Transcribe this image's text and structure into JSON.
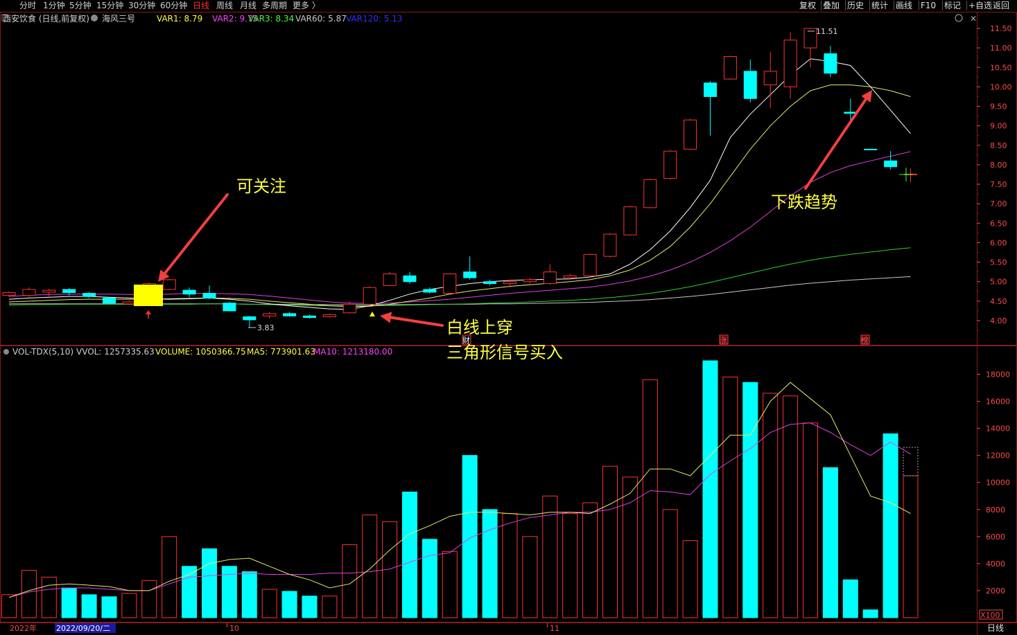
{
  "topbar": {
    "periods": [
      {
        "label": "分时",
        "active": false
      },
      {
        "label": "1分钟",
        "active": false
      },
      {
        "label": "5分钟",
        "active": false
      },
      {
        "label": "15分钟",
        "active": false
      },
      {
        "label": "30分钟",
        "active": false
      },
      {
        "label": "60分钟",
        "active": false
      },
      {
        "label": "日线",
        "active": true
      },
      {
        "label": "周线",
        "active": false
      },
      {
        "label": "月线",
        "active": false
      },
      {
        "label": "多周期",
        "active": false
      },
      {
        "label": "更多 〉",
        "active": false
      }
    ],
    "right_buttons": [
      "复权",
      "叠加",
      "历史",
      "统计",
      "画线",
      "F10",
      "标记",
      "+自选",
      "返回"
    ]
  },
  "main_panel": {
    "stock_title": "西安饮食 (日线,前复权)",
    "indicator_name": "海风三号",
    "legend": [
      {
        "label": "VAR1: 8.79",
        "color": "#ffff40"
      },
      {
        "label": "VAR2: 9.75",
        "color": "#ff40ff"
      },
      {
        "label": "VAR3: 8.34",
        "color": "#40ff40"
      },
      {
        "label": "VAR60: 5.87",
        "color": "#c8c8c8"
      },
      {
        "label": "VAR120: 5.13",
        "color": "#3030ff"
      }
    ],
    "price_axis": [
      "11.50",
      "11.00",
      "10.50",
      "10.00",
      "9.50",
      "9.00",
      "8.50",
      "8.00",
      "7.50",
      "7.00",
      "6.50",
      "6.00",
      "5.50",
      "5.00",
      "4.50",
      "4.00"
    ],
    "high_label": "11.51",
    "low_label": "3.83",
    "event_markers": [
      "财",
      "涨",
      "榜"
    ]
  },
  "annotations": {
    "watch": "可关注",
    "cross_line1": "白线上穿",
    "cross_line2": "三角形信号买入",
    "down": "下跌趋势"
  },
  "volume_panel": {
    "title": "VOL-TDX(5,10)",
    "legend": [
      {
        "label": "VVOL: 1257335.63",
        "color": "#c8c8c8"
      },
      {
        "label": "VOLUME: 1050366.75",
        "color": "#ffff40"
      },
      {
        "label": "MA5: 773901.63",
        "color": "#ffff40"
      },
      {
        "label": "MA10: 1213180.00",
        "color": "#ff40ff"
      }
    ],
    "vol_axis": [
      "18000",
      "16000",
      "14000",
      "12000",
      "10000",
      "8000",
      "6000",
      "4000",
      "2000"
    ],
    "multiplier": "X100"
  },
  "date_axis": {
    "year": "2022年",
    "cursor_date": "2022/09/20/二",
    "month_marks": [
      "10",
      "11"
    ],
    "period_label": "日线"
  },
  "colors": {
    "up": "#ff3232",
    "down": "#00ffff",
    "grid": "#8b1a1a",
    "axis_text": "#ff4a4a"
  },
  "chart_data": {
    "type": "candlestick",
    "price_ylim": [
      3.5,
      11.8
    ],
    "volume_ylim": [
      0,
      19200
    ],
    "candles": [
      {
        "o": 4.65,
        "c": 4.72,
        "h": 4.75,
        "l": 4.6,
        "v": 1700
      },
      {
        "o": 4.65,
        "c": 4.8,
        "h": 4.85,
        "l": 4.6,
        "v": 3500
      },
      {
        "o": 4.73,
        "c": 4.78,
        "h": 4.82,
        "l": 4.62,
        "v": 3000
      },
      {
        "o": 4.8,
        "c": 4.72,
        "h": 4.83,
        "l": 4.65,
        "v": 2200
      },
      {
        "o": 4.7,
        "c": 4.62,
        "h": 4.73,
        "l": 4.58,
        "v": 1700
      },
      {
        "o": 4.58,
        "c": 4.45,
        "h": 4.6,
        "l": 4.42,
        "v": 1550
      },
      {
        "o": 4.43,
        "c": 4.48,
        "h": 4.52,
        "l": 4.4,
        "v": 1800
      },
      {
        "o": 4.45,
        "c": 4.95,
        "h": 4.98,
        "l": 4.45,
        "v": 2750
      },
      {
        "o": 4.8,
        "c": 5.05,
        "h": 5.08,
        "l": 4.78,
        "v": 6000
      },
      {
        "o": 4.78,
        "c": 4.68,
        "h": 4.85,
        "l": 4.6,
        "v": 3800
      },
      {
        "o": 4.7,
        "c": 4.58,
        "h": 4.9,
        "l": 4.55,
        "v": 5100
      },
      {
        "o": 4.45,
        "c": 4.25,
        "h": 4.48,
        "l": 4.24,
        "v": 3800
      },
      {
        "o": 4.1,
        "c": 4.02,
        "h": 4.12,
        "l": 3.83,
        "v": 3400
      },
      {
        "o": 4.12,
        "c": 4.18,
        "h": 4.22,
        "l": 4.05,
        "v": 2100
      },
      {
        "o": 4.18,
        "c": 4.12,
        "h": 4.22,
        "l": 4.1,
        "v": 1950
      },
      {
        "o": 4.12,
        "c": 4.08,
        "h": 4.15,
        "l": 4.05,
        "v": 1600
      },
      {
        "o": 4.1,
        "c": 4.15,
        "h": 4.18,
        "l": 4.08,
        "v": 1600
      },
      {
        "o": 4.2,
        "c": 4.42,
        "h": 4.5,
        "l": 4.18,
        "v": 5400
      },
      {
        "o": 4.42,
        "c": 4.85,
        "h": 4.88,
        "l": 4.4,
        "v": 7600
      },
      {
        "o": 4.9,
        "c": 5.2,
        "h": 5.25,
        "l": 4.88,
        "v": 7100
      },
      {
        "o": 5.15,
        "c": 5.0,
        "h": 5.25,
        "l": 4.95,
        "v": 9300
      },
      {
        "o": 4.8,
        "c": 4.73,
        "h": 4.85,
        "l": 4.7,
        "v": 5800
      },
      {
        "o": 4.7,
        "c": 5.2,
        "h": 5.22,
        "l": 4.68,
        "v": 4900
      },
      {
        "o": 5.25,
        "c": 5.1,
        "h": 5.65,
        "l": 5.05,
        "v": 12000
      },
      {
        "o": 5.0,
        "c": 4.95,
        "h": 5.05,
        "l": 4.9,
        "v": 8000
      },
      {
        "o": 4.95,
        "c": 5.0,
        "h": 5.05,
        "l": 4.85,
        "v": 7700
      },
      {
        "o": 5.0,
        "c": 5.05,
        "h": 5.1,
        "l": 4.95,
        "v": 6000
      },
      {
        "o": 4.95,
        "c": 5.25,
        "h": 5.45,
        "l": 4.92,
        "v": 9000
      },
      {
        "o": 5.1,
        "c": 5.15,
        "h": 5.2,
        "l": 5.05,
        "v": 7700
      },
      {
        "o": 5.15,
        "c": 5.7,
        "h": 5.72,
        "l": 5.1,
        "v": 8500
      },
      {
        "o": 5.65,
        "c": 6.22,
        "h": 6.25,
        "l": 5.62,
        "v": 11200
      },
      {
        "o": 6.2,
        "c": 6.92,
        "h": 6.95,
        "l": 6.18,
        "v": 10400
      },
      {
        "o": 6.9,
        "c": 7.62,
        "h": 7.65,
        "l": 6.88,
        "v": 17600
      },
      {
        "o": 7.65,
        "c": 8.35,
        "h": 8.38,
        "l": 7.62,
        "v": 8000
      },
      {
        "o": 8.4,
        "c": 9.15,
        "h": 9.18,
        "l": 8.38,
        "v": 5700
      },
      {
        "o": 10.1,
        "c": 9.75,
        "h": 10.15,
        "l": 8.75,
        "v": 19000
      },
      {
        "o": 10.2,
        "c": 10.78,
        "h": 10.8,
        "l": 10.18,
        "v": 17800
      },
      {
        "o": 10.4,
        "c": 9.7,
        "h": 10.7,
        "l": 9.6,
        "v": 17400
      },
      {
        "o": 10.05,
        "c": 10.4,
        "h": 10.9,
        "l": 9.45,
        "v": 16600
      },
      {
        "o": 10.0,
        "c": 11.2,
        "h": 11.4,
        "l": 9.7,
        "v": 16400
      },
      {
        "o": 11.0,
        "c": 11.5,
        "h": 11.51,
        "l": 10.5,
        "v": 14400
      },
      {
        "o": 10.85,
        "c": 10.35,
        "h": 11.05,
        "l": 10.25,
        "v": 11100
      },
      {
        "o": 9.35,
        "c": 9.32,
        "h": 9.7,
        "l": 9.1,
        "v": 2800
      },
      {
        "o": 8.4,
        "c": 8.39,
        "h": 8.41,
        "l": 8.38,
        "v": 580
      },
      {
        "o": 8.1,
        "c": 7.95,
        "h": 8.35,
        "l": 7.88,
        "v": 13600
      },
      {
        "o": 7.75,
        "c": 7.76,
        "h": 7.9,
        "l": 7.55,
        "v": 10500
      }
    ],
    "line_white": [
      4.55,
      4.58,
      4.6,
      4.62,
      4.62,
      4.6,
      4.58,
      4.56,
      4.55,
      4.56,
      4.58,
      4.55,
      4.5,
      4.43,
      4.38,
      4.34,
      4.3,
      4.29,
      4.38,
      4.52,
      4.68,
      4.8,
      4.88,
      4.95,
      5.0,
      5.03,
      5.05,
      5.06,
      5.07,
      5.12,
      5.2,
      5.45,
      5.82,
      6.3,
      6.9,
      7.6,
      8.7,
      9.3,
      9.8,
      10.3,
      10.72,
      10.65,
      10.55,
      10.0,
      9.4,
      8.8
    ],
    "line_yellow": [
      4.48,
      4.5,
      4.52,
      4.54,
      4.55,
      4.55,
      4.55,
      4.55,
      4.56,
      4.57,
      4.58,
      4.57,
      4.55,
      4.5,
      4.46,
      4.42,
      4.38,
      4.36,
      4.37,
      4.42,
      4.5,
      4.58,
      4.68,
      4.76,
      4.82,
      4.88,
      4.92,
      4.96,
      5.0,
      5.05,
      5.15,
      5.3,
      5.55,
      5.9,
      6.4,
      7.0,
      7.7,
      8.4,
      9.0,
      9.5,
      9.9,
      10.05,
      10.05,
      10.0,
      9.9,
      9.75
    ],
    "line_magenta": [
      4.62,
      4.65,
      4.67,
      4.68,
      4.68,
      4.68,
      4.67,
      4.67,
      4.68,
      4.7,
      4.7,
      4.69,
      4.67,
      4.63,
      4.58,
      4.53,
      4.48,
      4.45,
      4.44,
      4.45,
      4.48,
      4.51,
      4.55,
      4.6,
      4.65,
      4.7,
      4.74,
      4.78,
      4.82,
      4.86,
      4.93,
      5.02,
      5.14,
      5.3,
      5.5,
      5.75,
      6.05,
      6.4,
      6.8,
      7.2,
      7.55,
      7.8,
      7.98,
      8.1,
      8.22,
      8.34
    ],
    "line_green": [
      4.4,
      4.41,
      4.41,
      4.42,
      4.42,
      4.42,
      4.42,
      4.42,
      4.42,
      4.42,
      4.43,
      4.43,
      4.42,
      4.41,
      4.4,
      4.39,
      4.38,
      4.38,
      4.38,
      4.39,
      4.4,
      4.41,
      4.42,
      4.43,
      4.45,
      4.46,
      4.48,
      4.5,
      4.52,
      4.55,
      4.59,
      4.64,
      4.7,
      4.78,
      4.87,
      4.98,
      5.1,
      5.22,
      5.34,
      5.45,
      5.55,
      5.63,
      5.7,
      5.76,
      5.82,
      5.87
    ],
    "line_grey": [
      4.43,
      4.43,
      4.43,
      4.43,
      4.43,
      4.43,
      4.43,
      4.43,
      4.43,
      4.43,
      4.43,
      4.43,
      4.42,
      4.42,
      4.42,
      4.41,
      4.41,
      4.41,
      4.41,
      4.41,
      4.41,
      4.42,
      4.42,
      4.42,
      4.43,
      4.43,
      4.44,
      4.45,
      4.46,
      4.47,
      4.49,
      4.51,
      4.54,
      4.58,
      4.62,
      4.67,
      4.73,
      4.79,
      4.85,
      4.91,
      4.96,
      5.0,
      5.04,
      5.07,
      5.1,
      5.13
    ],
    "ma5_vol": [
      1500,
      2000,
      2400,
      2500,
      2400,
      2300,
      2000,
      2000,
      2700,
      3200,
      4000,
      4300,
      4400,
      3800,
      3200,
      2800,
      2200,
      2500,
      3600,
      5000,
      6200,
      6800,
      7500,
      7800,
      7800,
      7700,
      7600,
      7800,
      7800,
      7700,
      8400,
      9200,
      11000,
      11000,
      10500,
      12000,
      13500,
      13500,
      16000,
      17400,
      16200,
      15000,
      12000,
      9000,
      8500,
      7700
    ],
    "ma10_vol": [
      1500,
      1900,
      2100,
      2200,
      2200,
      2100,
      2000,
      2000,
      2500,
      3000,
      3100,
      3200,
      3300,
      3200,
      3200,
      3200,
      3300,
      3300,
      3400,
      3600,
      4100,
      4600,
      4800,
      5900,
      6500,
      7000,
      7400,
      7600,
      7800,
      7800,
      8000,
      8500,
      9400,
      9300,
      9100,
      10600,
      11600,
      12500,
      13700,
      14300,
      14400,
      13700,
      12800,
      12000,
      13000,
      12100
    ]
  }
}
